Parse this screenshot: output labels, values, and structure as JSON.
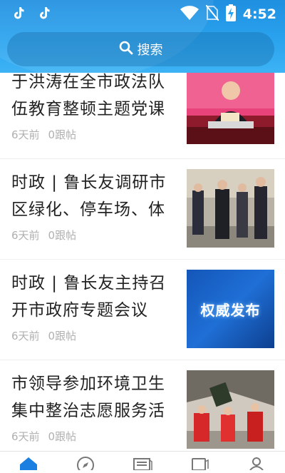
{
  "status_bar": {
    "time": "4:52"
  },
  "search": {
    "label": "搜索"
  },
  "news": [
    {
      "title": "于洪涛在全市政法队伍教育整顿主题党课",
      "age": "6天前",
      "replies": "0跟帖"
    },
    {
      "title": "时政 | 鲁长友调研市区绿化、停车场、体",
      "age": "6天前",
      "replies": "0跟帖"
    },
    {
      "title": "时政 | 鲁长友主持召开市政府专题会议",
      "age": "6天前",
      "replies": "0跟帖",
      "thumb_text": "权威发布"
    },
    {
      "title": "市领导参加环境卫生集中整治志愿服务活",
      "age": "6天前",
      "replies": "0跟帖"
    }
  ],
  "tabs": [
    {
      "icon": "home-icon",
      "active": true
    },
    {
      "icon": "compass-icon",
      "active": false
    },
    {
      "icon": "newspaper-icon",
      "active": false
    },
    {
      "icon": "tablet-icon",
      "active": false
    },
    {
      "icon": "user-icon",
      "active": false
    }
  ],
  "colors": {
    "header_top": "#1f8fe0",
    "header_bottom": "#3db3f5",
    "accent": "#1a7fe0",
    "meta_text": "#b0b0b0"
  }
}
